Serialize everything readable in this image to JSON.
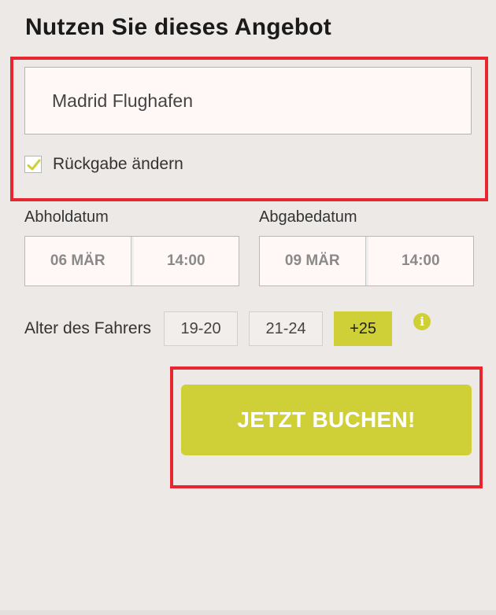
{
  "title": "Nutzen Sie dieses Angebot",
  "location": {
    "value": "Madrid Flughafen"
  },
  "return_change": {
    "label": "Rückgabe ändern",
    "checked": true
  },
  "pickup": {
    "label": "Abholdatum",
    "date": "06 MÄR",
    "time": "14:00"
  },
  "dropoff": {
    "label": "Abgabedatum",
    "date": "09 MÄR",
    "time": "14:00"
  },
  "driver_age": {
    "label": "Alter des Fahrers",
    "options": [
      "19-20",
      "21-24",
      "+25"
    ],
    "selected": "+25",
    "info_icon": "info-icon"
  },
  "book_button": {
    "label": "JETZT BUCHEN!"
  },
  "colors": {
    "accent": "#cfd037",
    "highlight": "#e8262f",
    "background": "#ede9e6"
  }
}
